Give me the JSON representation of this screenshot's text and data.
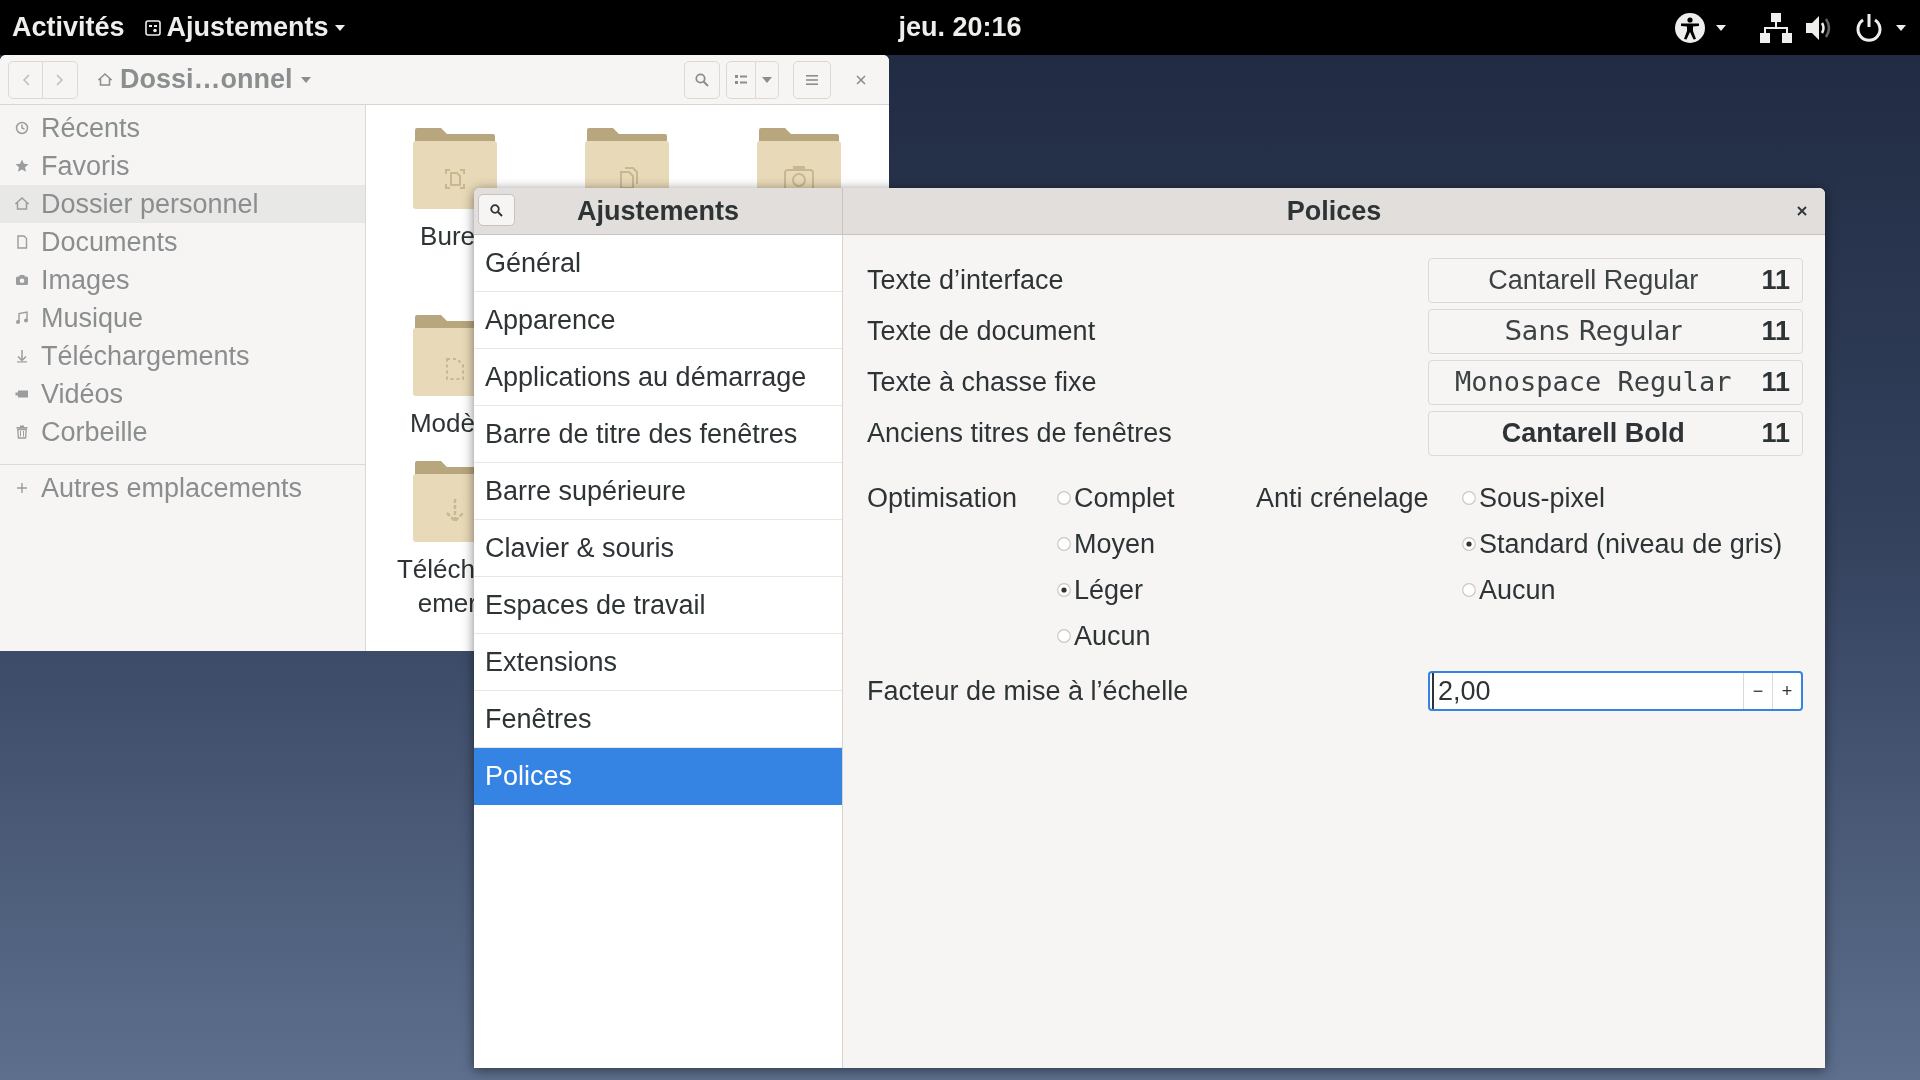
{
  "top_bar": {
    "activities": "Activités",
    "app_menu": "Ajustements",
    "clock": "jeu. 20:16"
  },
  "file_manager": {
    "path": "Dossi…onnel",
    "places": [
      {
        "label": "Récents",
        "selected": false
      },
      {
        "label": "Favoris",
        "selected": false
      },
      {
        "label": "Dossier personnel",
        "selected": true
      },
      {
        "label": "Documents",
        "selected": false
      },
      {
        "label": "Images",
        "selected": false
      },
      {
        "label": "Musique",
        "selected": false
      },
      {
        "label": "Téléchargements",
        "selected": false
      },
      {
        "label": "Vidéos",
        "selected": false
      },
      {
        "label": "Corbeille",
        "selected": false
      }
    ],
    "other_locations": "Autres emplacements",
    "folders": [
      {
        "kind": "desktop",
        "label_lines": [
          "Bure"
        ]
      },
      {
        "kind": "document"
      },
      {
        "kind": "camera"
      },
      {
        "kind": "template",
        "label_lines": [
          "Modè"
        ]
      },
      {
        "kind": "download",
        "label_lines": [
          "Téléch",
          "emer"
        ]
      }
    ]
  },
  "tweaks": {
    "sidebar_title": "Ajustements",
    "panel_title": "Polices",
    "sections": [
      {
        "label": "Général",
        "selected": false
      },
      {
        "label": "Apparence",
        "selected": false
      },
      {
        "label": "Applications au démarrage",
        "selected": false
      },
      {
        "label": "Barre de titre des fenêtres",
        "selected": false
      },
      {
        "label": "Barre supérieure",
        "selected": false
      },
      {
        "label": "Clavier & souris",
        "selected": false
      },
      {
        "label": "Espaces de travail",
        "selected": false
      },
      {
        "label": "Extensions",
        "selected": false
      },
      {
        "label": "Fenêtres",
        "selected": false
      },
      {
        "label": "Polices",
        "selected": true
      }
    ],
    "fonts": [
      {
        "label": "Texte d’interface",
        "font": "Cantarell Regular",
        "size": "11",
        "kind": "ui"
      },
      {
        "label": "Texte de document",
        "font": "Sans Regular",
        "size": "11",
        "kind": "sans"
      },
      {
        "label": "Texte à chasse fixe",
        "font": "Monospace Regular",
        "size": "11",
        "kind": "mono"
      },
      {
        "label": "Anciens titres de fenêtres",
        "font": "Cantarell Bold",
        "size": "11",
        "kind": "bold"
      }
    ],
    "hinting": {
      "label": "Optimisation",
      "options": [
        {
          "label": "Complet",
          "selected": false
        },
        {
          "label": "Moyen",
          "selected": false
        },
        {
          "label": "Léger",
          "selected": true
        },
        {
          "label": "Aucun",
          "selected": false
        }
      ]
    },
    "antialiasing": {
      "label": "Anti crénelage",
      "options": [
        {
          "label": "Sous-pixel",
          "selected": false
        },
        {
          "label": "Standard (niveau de gris)",
          "selected": true
        },
        {
          "label": "Aucun",
          "selected": false
        }
      ]
    },
    "scaling": {
      "label": "Facteur de mise à l’échelle",
      "value": "2,00",
      "decrement": "−",
      "increment": "+"
    }
  }
}
